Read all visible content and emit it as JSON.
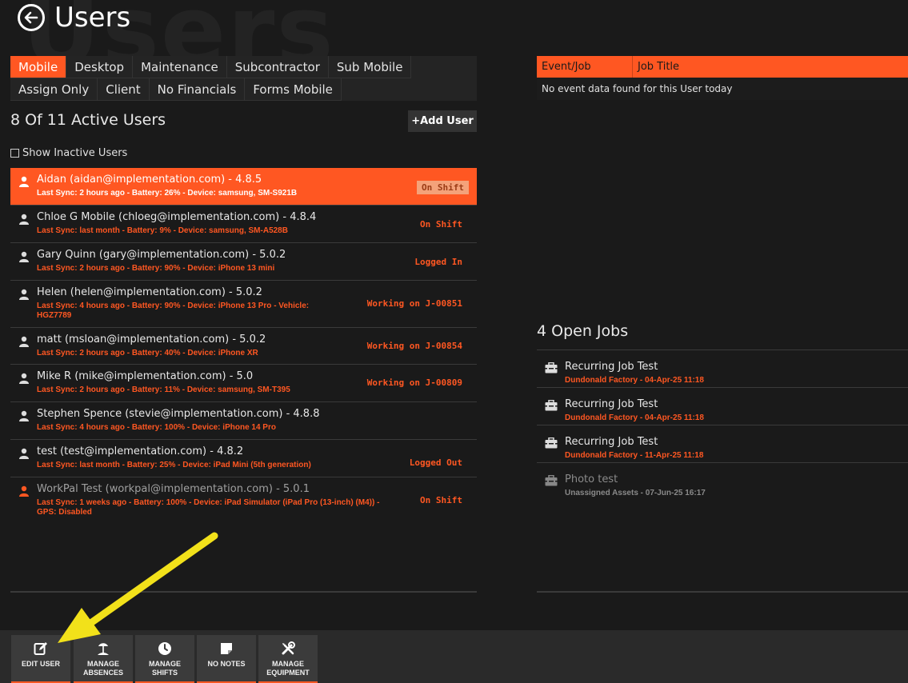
{
  "page": {
    "title": "Users",
    "watermark": "Users"
  },
  "tabs": [
    {
      "label": "Mobile",
      "active": true
    },
    {
      "label": "Desktop"
    },
    {
      "label": "Maintenance"
    },
    {
      "label": "Subcontractor"
    },
    {
      "label": "Sub Mobile"
    },
    {
      "label": "Assign Only"
    },
    {
      "label": "Client"
    },
    {
      "label": "No Financials"
    },
    {
      "label": "Forms Mobile"
    }
  ],
  "users_panel": {
    "count_label": "8 Of 11 Active Users",
    "add_user_label": "+Add User",
    "show_inactive_label": "Show Inactive Users"
  },
  "users": [
    {
      "name": "Aidan (aidan@implementation.com) - 4.8.5",
      "details": "Last Sync: 2 hours ago - Battery: 26% - Device: samsung, SM-S921B",
      "status": "On Shift"
    },
    {
      "name": "Chloe G Mobile (chloeg@implementation.com) - 4.8.4",
      "details": "Last Sync: last month - Battery: 9% - Device: samsung, SM-A528B",
      "status": "On Shift"
    },
    {
      "name": "Gary Quinn (gary@implementation.com) - 5.0.2",
      "details": "Last Sync: 2 hours ago - Battery: 90% - Device: iPhone 13 mini",
      "status": "Logged In"
    },
    {
      "name": "Helen (helen@implementation.com) - 5.0.2",
      "details": "Last Sync: 4 hours ago - Battery: 90% - Device: iPhone 13 Pro - Vehicle: HGZ7789",
      "status": "Working on J-00851"
    },
    {
      "name": "matt (msloan@implementation.com) - 5.0.2",
      "details": "Last Sync: 2 hours ago - Battery: 40% - Device: iPhone XR",
      "status": "Working on J-00854"
    },
    {
      "name": "Mike R (mike@implementation.com) - 5.0",
      "details": "Last Sync: 2 hours ago - Battery: 11% - Device: samsung, SM-T395",
      "status": "Working on J-00809"
    },
    {
      "name": "Stephen Spence (stevie@implementation.com) - 4.8.8",
      "details": "Last Sync: 4 hours ago - Battery: 100% - Device: iPhone 14 Pro",
      "status": ""
    },
    {
      "name": "test (test@implementation.com) - 4.8.2",
      "details": "Last Sync: last month - Battery: 25% - Device: iPad Mini (5th generation)",
      "status": "Logged Out"
    },
    {
      "name": "WorkPal Test (workpal@implementation.com) - 5.0.1",
      "details": "Last Sync: 1 weeks ago - Battery: 100% - Device: iPad Simulator (iPad Pro (13-inch) (M4)) - GPS: Disabled",
      "status": "On Shift"
    }
  ],
  "events": {
    "col_event": "Event/Job",
    "col_title": "Job Title",
    "empty_message": "No event data found for this User today"
  },
  "jobs_panel": {
    "title": "4 Open Jobs"
  },
  "jobs": [
    {
      "name": "Recurring Job Test",
      "details": "Dundonald Factory - 04-Apr-25 11:18"
    },
    {
      "name": "Recurring Job Test",
      "details": "Dundonald Factory - 04-Apr-25 11:18"
    },
    {
      "name": "Recurring Job Test",
      "details": "Dundonald Factory - 11-Apr-25 11:18"
    },
    {
      "name": "Photo test",
      "details": "Unassigned Assets - 07-Jun-25 16:17"
    }
  ],
  "toolbar": {
    "edit_user": "EDIT USER",
    "manage_absences": "MANAGE ABSENCES",
    "manage_shifts": "MANAGE SHIFTS",
    "no_notes": "NO NOTES",
    "manage_equipment": "MANAGE EQUIPMENT"
  },
  "colors": {
    "accent": "#ff5722",
    "background": "#1a1a1a",
    "annotation_arrow": "#f2e11a"
  }
}
